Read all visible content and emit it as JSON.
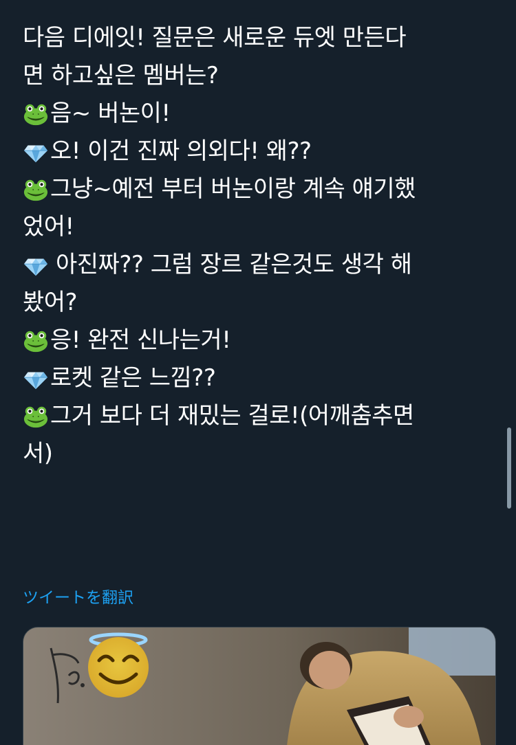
{
  "tweet": {
    "lines": [
      {
        "icon": "",
        "text": "다음 디에잇! 질문은 새로운 듀엣 만든다"
      },
      {
        "icon": "",
        "text": "면 하고싶은 멤버는?"
      },
      {
        "icon": "frog-icon",
        "text": "음~ 버논이!"
      },
      {
        "icon": "gem-icon",
        "text": "오! 이건 진짜 의외다! 왜??"
      },
      {
        "icon": "frog-icon",
        "text": "그냥~예전 부터 버논이랑 계속 얘기했"
      },
      {
        "icon": "",
        "text": "었어!"
      },
      {
        "icon": "gem-icon",
        "text": "아진짜?? 그럼 장르 같은것도 생각 해",
        "gap": true
      },
      {
        "icon": "",
        "text": "봤어?"
      },
      {
        "icon": "frog-icon",
        "text": "응! 완전 신나는거!"
      },
      {
        "icon": "gem-icon",
        "text": "로켓 같은 느낌??"
      },
      {
        "icon": "frog-icon",
        "text": "그거 보다 더 재밌는 걸로!(어깨춤추면"
      },
      {
        "icon": "",
        "text": "서)"
      }
    ],
    "translate_label": "ツイートを翻訳"
  },
  "media": {
    "emoji_icon": "smiling-face-with-halo-icon"
  },
  "colors": {
    "background": "#15202b",
    "text": "#ffffff",
    "link": "#1da1f2"
  }
}
